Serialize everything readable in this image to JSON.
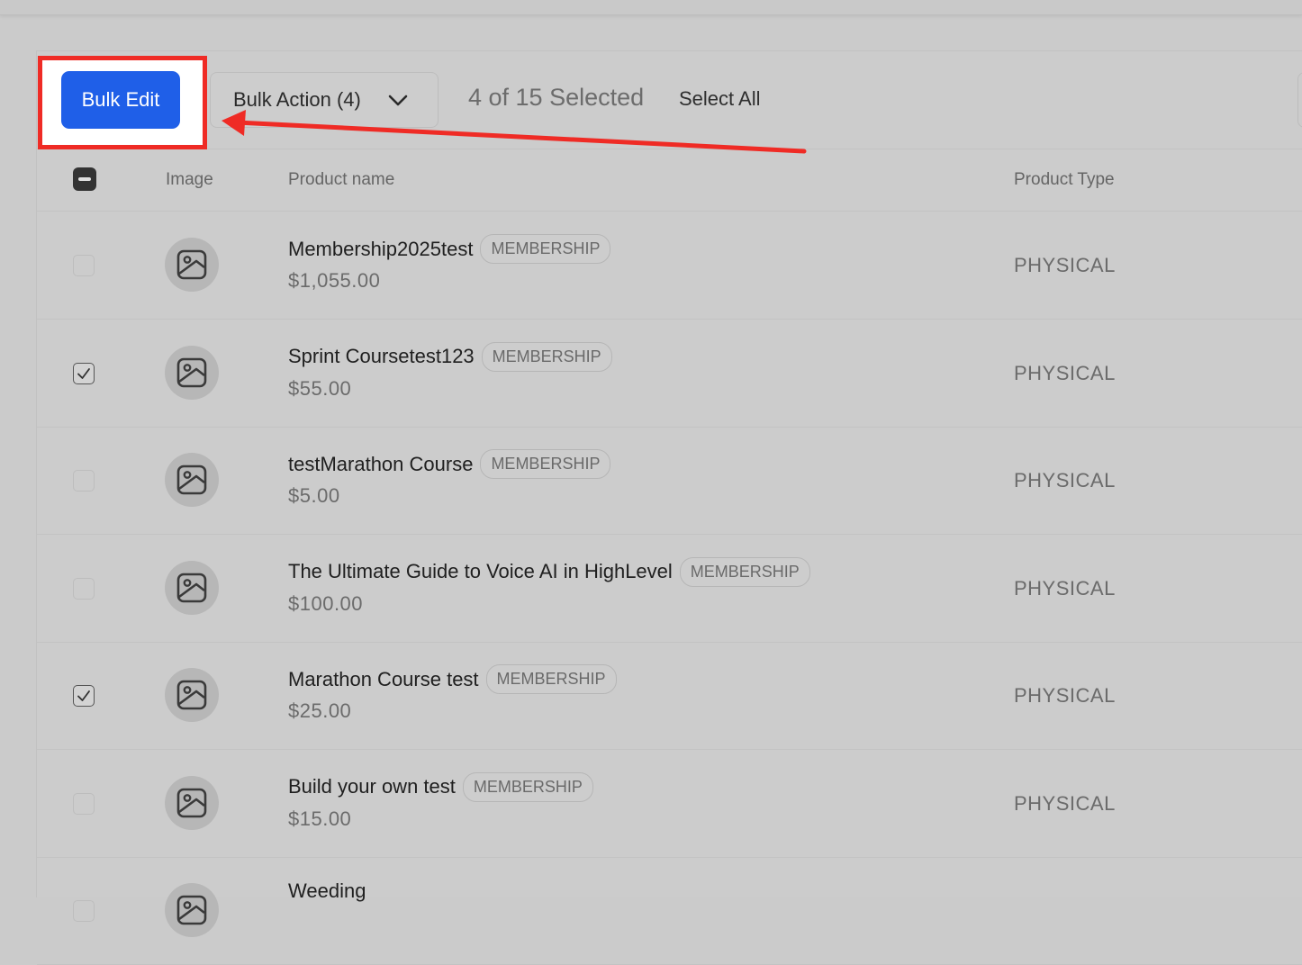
{
  "toolbar": {
    "bulk_edit_label": "Bulk Edit",
    "bulk_action_label": "Bulk Action (4)",
    "selected_text": "4 of 15 Selected",
    "select_all_label": "Select All"
  },
  "table": {
    "headers": {
      "image": "Image",
      "product_name": "Product name",
      "product_type": "Product Type"
    },
    "rows": [
      {
        "name": "Membership2025test",
        "badge": "MEMBERSHIP",
        "price": "$1,055.00",
        "type": "PHYSICAL",
        "checked": false
      },
      {
        "name": "Sprint Coursetest123",
        "badge": "MEMBERSHIP",
        "price": "$55.00",
        "type": "PHYSICAL",
        "checked": true
      },
      {
        "name": "testMarathon Course",
        "badge": "MEMBERSHIP",
        "price": "$5.00",
        "type": "PHYSICAL",
        "checked": false
      },
      {
        "name": "The Ultimate Guide to Voice AI in HighLevel",
        "badge": "MEMBERSHIP",
        "price": "$100.00",
        "type": "PHYSICAL",
        "checked": false
      },
      {
        "name": "Marathon Course test",
        "badge": "MEMBERSHIP",
        "price": "$25.00",
        "type": "PHYSICAL",
        "checked": true
      },
      {
        "name": "Build your own test",
        "badge": "MEMBERSHIP",
        "price": "$15.00",
        "type": "PHYSICAL",
        "checked": false
      },
      {
        "name": "Weeding",
        "badge": "",
        "price": "",
        "type": "",
        "checked": false
      }
    ]
  },
  "colors": {
    "accent": "#1f5fe8",
    "annotation": "#ef2b25",
    "background": "#cbcbcb"
  },
  "icons": {
    "chevron": "chevron-down-icon",
    "image_placeholder": "image-icon",
    "check": "check-icon"
  }
}
